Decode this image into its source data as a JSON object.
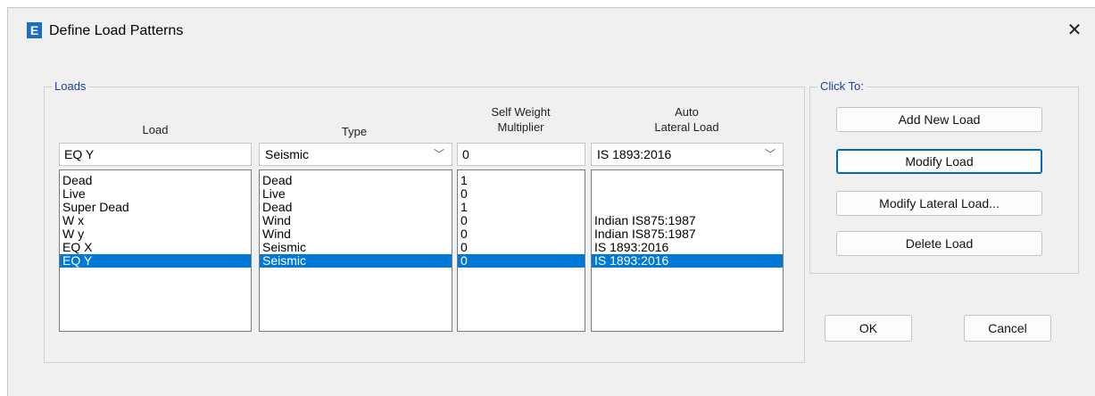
{
  "window": {
    "title": "Define Load Patterns",
    "icon_letter": "E",
    "close_glyph": "✕"
  },
  "loads_group": {
    "label": "Loads"
  },
  "columns": {
    "load": "Load",
    "type": "Type",
    "multiplier_line1": "Self Weight",
    "multiplier_line2": "Multiplier",
    "lateral_line1": "Auto",
    "lateral_line2": "Lateral Load"
  },
  "edit_row": {
    "load": "EQ Y",
    "type": "Seismic",
    "multiplier": "0",
    "lateral": "IS 1893:2016"
  },
  "rows": [
    {
      "load": "Dead",
      "type": "Dead",
      "multiplier": "1",
      "lateral": ""
    },
    {
      "load": "Live",
      "type": "Live",
      "multiplier": "0",
      "lateral": ""
    },
    {
      "load": "Super Dead",
      "type": "Dead",
      "multiplier": "1",
      "lateral": ""
    },
    {
      "load": "W x",
      "type": "Wind",
      "multiplier": "0",
      "lateral": "Indian IS875:1987"
    },
    {
      "load": "W y",
      "type": "Wind",
      "multiplier": "0",
      "lateral": "Indian IS875:1987"
    },
    {
      "load": "EQ X",
      "type": "Seismic",
      "multiplier": "0",
      "lateral": "IS 1893:2016"
    },
    {
      "load": "EQ Y",
      "type": "Seismic",
      "multiplier": "0",
      "lateral": "IS 1893:2016",
      "selected": true
    }
  ],
  "click_to_group": {
    "label": "Click To:"
  },
  "buttons": {
    "add": "Add New Load",
    "modify": "Modify Load",
    "modify_lateral": "Modify Lateral Load...",
    "delete": "Delete Load",
    "ok": "OK",
    "cancel": "Cancel"
  },
  "colors": {
    "selection": "#0078d7",
    "group_label": "#1a3fa0",
    "icon_bg": "#1a6fc4"
  }
}
